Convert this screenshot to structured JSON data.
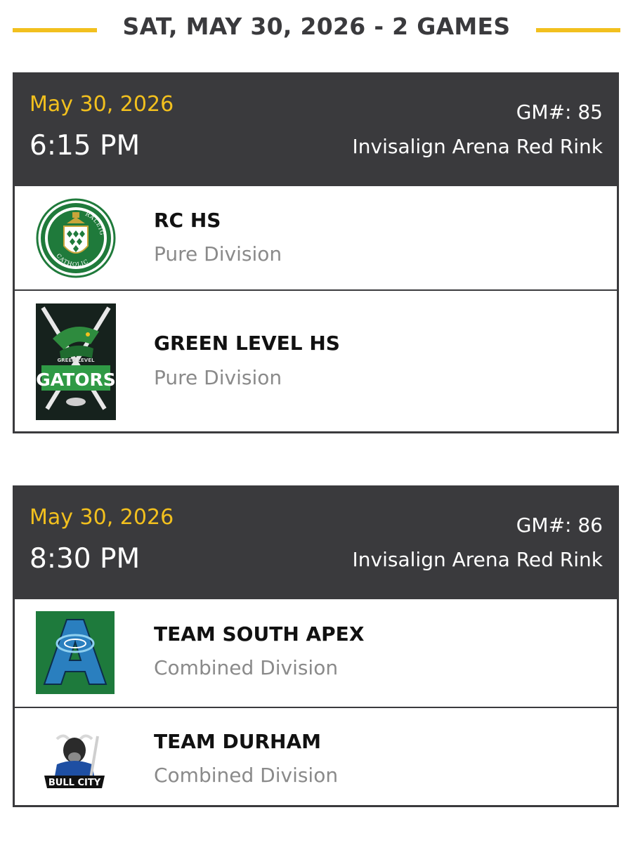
{
  "schedule": {
    "day_heading": "SAT, MAY 30, 2026 - 2 GAMES",
    "accent_color": "#f2c01e",
    "header_bg": "#3a3a3d",
    "games": [
      {
        "date": "May 30, 2026",
        "time": "6:15 PM",
        "game_number": "GM#: 85",
        "venue": "Invisalign Arena Red Rink",
        "teams": [
          {
            "name": "RC HS",
            "division": "Pure Division",
            "logo": "raleigh-catholic-logo",
            "logo_text_top": "RALEIGH",
            "logo_text_bottom": "CATHOLIC"
          },
          {
            "name": "GREEN LEVEL HS",
            "division": "Pure Division",
            "logo": "green-level-gators-logo",
            "logo_text_small": "GREEN LEVEL",
            "logo_text_main": "GATORS"
          }
        ]
      },
      {
        "date": "May 30, 2026",
        "time": "8:30 PM",
        "game_number": "GM#: 86",
        "venue": "Invisalign Arena Red Rink",
        "teams": [
          {
            "name": "TEAM SOUTH APEX",
            "division": "Combined Division",
            "logo": "south-apex-logo"
          },
          {
            "name": "TEAM DURHAM",
            "division": "Combined Division",
            "logo": "bull-city-logo",
            "logo_text_main": "BULL CITY"
          }
        ]
      }
    ]
  }
}
